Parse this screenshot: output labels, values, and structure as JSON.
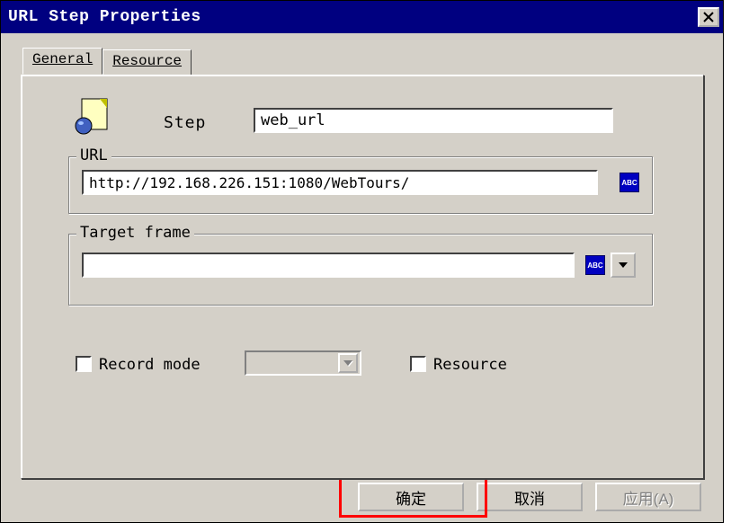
{
  "window": {
    "title": "URL Step Properties"
  },
  "tabs": {
    "general": "General",
    "resource": "Resource"
  },
  "step": {
    "label": "Step",
    "value": "web_url"
  },
  "url": {
    "legend": "URL",
    "value": "http://192.168.226.151:1080/WebTours/",
    "abc_label": "ABC"
  },
  "frame": {
    "legend": "Target frame",
    "value": "",
    "abc_label": "ABC"
  },
  "record": {
    "label": "Record mode",
    "value": ""
  },
  "resource_cb": {
    "label": "Resource"
  },
  "buttons": {
    "ok": "确定",
    "cancel": "取消",
    "apply": "应用(A)"
  }
}
